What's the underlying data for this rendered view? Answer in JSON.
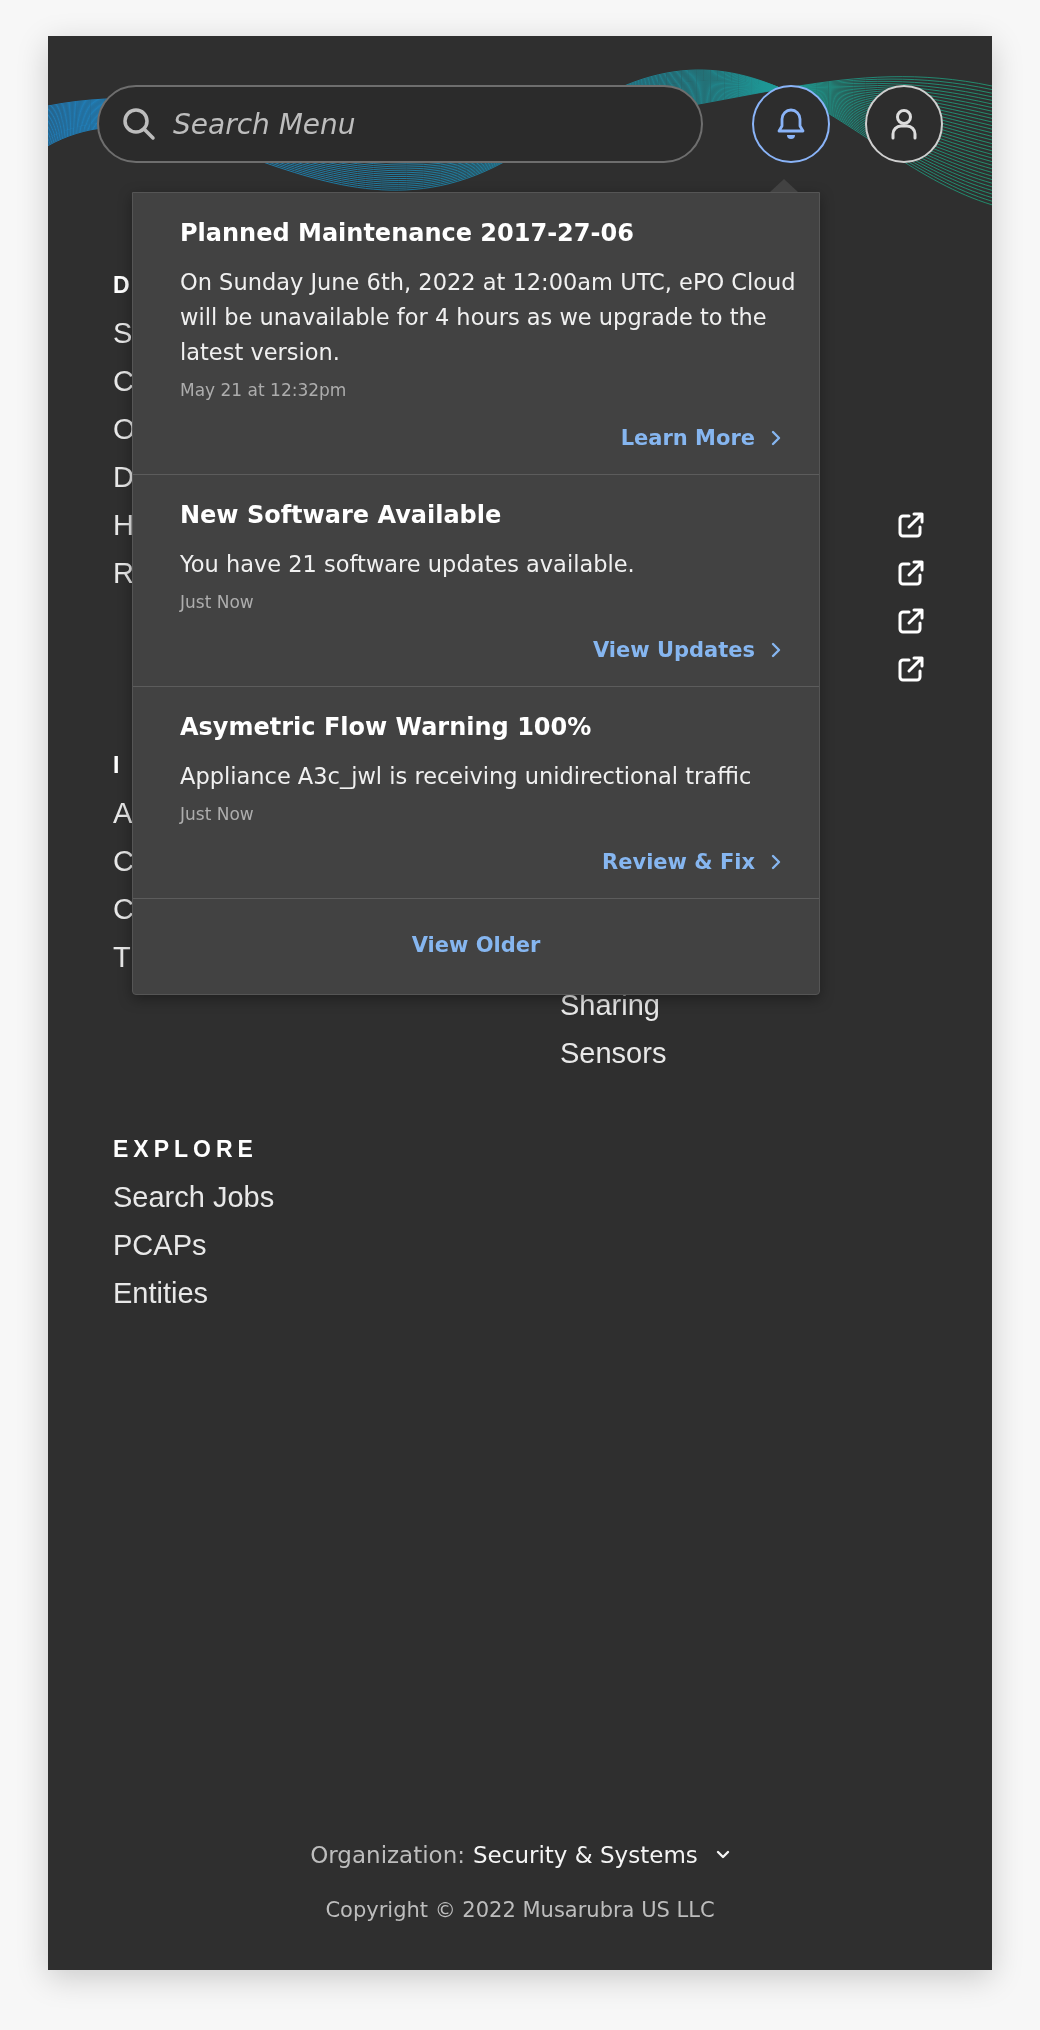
{
  "header": {
    "search": {
      "placeholder": "Search Menu"
    },
    "notifications_button": {
      "selected": true
    },
    "account_button": {
      "selected": false
    }
  },
  "menu": {
    "sections": [
      {
        "heading": "D",
        "items": [
          {
            "label": "S"
          },
          {
            "label": "C"
          },
          {
            "label": "O"
          },
          {
            "label": "D"
          },
          {
            "label": "H"
          },
          {
            "label": "R"
          }
        ],
        "right_items": [
          {
            "external": true
          },
          {
            "external": true
          },
          {
            "external": true
          },
          {
            "external": true
          }
        ]
      },
      {
        "heading": "I",
        "items": [
          {
            "label": "A"
          },
          {
            "label": "C"
          },
          {
            "label": "C"
          },
          {
            "label": "T"
          }
        ],
        "right_items": [
          {
            "label": "Sharing"
          },
          {
            "label": "Sensors"
          }
        ]
      },
      {
        "heading": "EXPLORE",
        "items": [
          {
            "label": "Search Jobs"
          },
          {
            "label": "PCAPs"
          },
          {
            "label": "Entities"
          }
        ]
      }
    ]
  },
  "notifications": {
    "open": true,
    "items": [
      {
        "title": "Planned Maintenance 2017-27-06",
        "message": "On Sunday June 6th, 2022 at 12:00am UTC, ePO Cloud will be unavailable for 4 hours as we upgrade to the latest version.",
        "time": "May 21 at 12:32pm",
        "action": "Learn More"
      },
      {
        "title": "New Software Available",
        "message": "You have 21 software updates available.",
        "time": "Just Now",
        "action": "View Updates"
      },
      {
        "title": "Asymetric Flow Warning 100%",
        "message": "Appliance A3c_jwl is receiving unidirectional traffic",
        "time": "Just Now",
        "action": "Review & Fix"
      }
    ],
    "footer_link": "View Older"
  },
  "footer": {
    "organization_label": "Organization:",
    "organization": "Security & Systems",
    "copyright": "Copyright © 2022 Musarubra US LLC"
  }
}
